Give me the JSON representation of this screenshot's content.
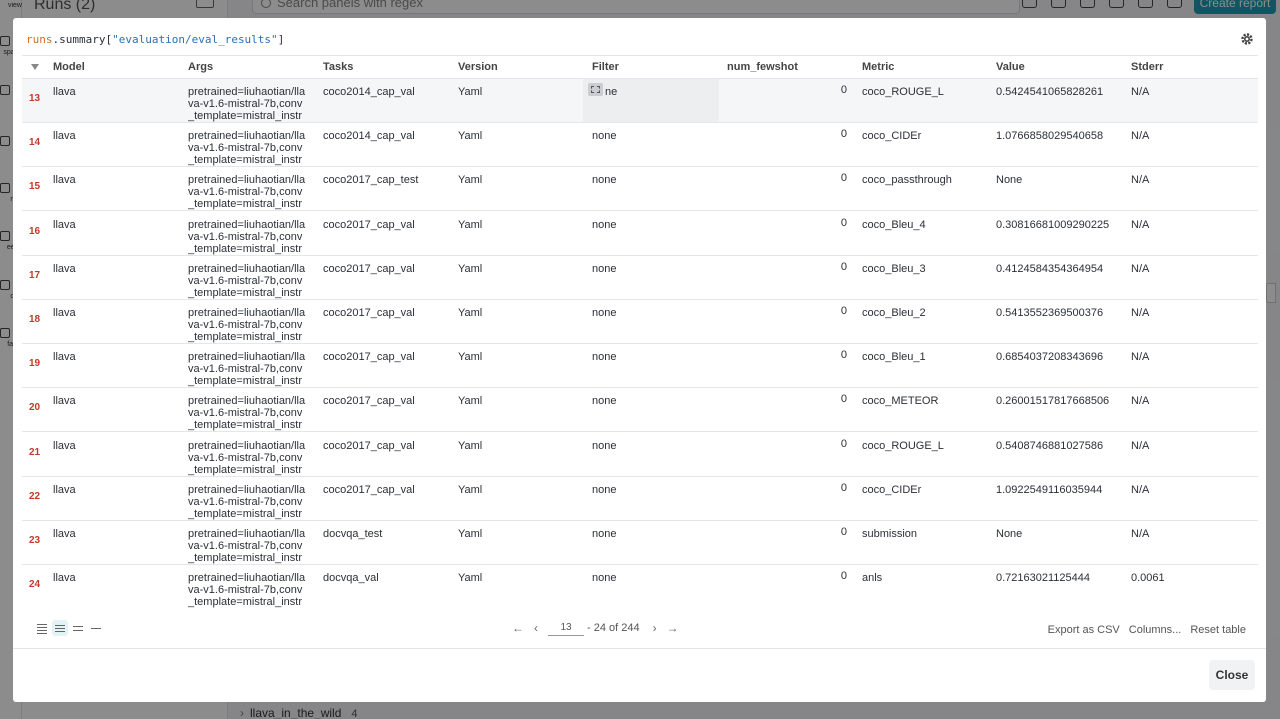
{
  "background": {
    "runs_title": "Runs (2)",
    "search_placeholder": "Search panels with regex",
    "create_report": "Create report",
    "nav_labels": [
      "view",
      "space",
      "ns",
      "bs",
      "mat",
      "eeps",
      "orts",
      "facts"
    ],
    "group_name": "llava_in_the_wild",
    "group_count": "4"
  },
  "modal": {
    "expr": {
      "prefix": "runs",
      "mid": ".summary[",
      "key": "\"evaluation/eval_results\"",
      "suffix": "]"
    },
    "columns": [
      "Model",
      "Args",
      "Tasks",
      "Version",
      "Filter",
      "num_fewshot",
      "Metric",
      "Value",
      "Stderr"
    ],
    "rows": [
      {
        "idx": "13",
        "model": "llava",
        "args": "pretrained=liuhaotian/llava-v1.6-mistral-7b,conv_template=mistral_instruct",
        "tasks": "coco2014_cap_val",
        "version": "Yaml",
        "filter": "ne",
        "fewshot": "0",
        "metric": "coco_ROUGE_L",
        "value": "0.5424541065828261",
        "stderr": "N/A"
      },
      {
        "idx": "14",
        "model": "llava",
        "args": "pretrained=liuhaotian/llava-v1.6-mistral-7b,conv_template=mistral_instruct",
        "tasks": "coco2014_cap_val",
        "version": "Yaml",
        "filter": "none",
        "fewshot": "0",
        "metric": "coco_CIDEr",
        "value": "1.0766858029540658",
        "stderr": "N/A"
      },
      {
        "idx": "15",
        "model": "llava",
        "args": "pretrained=liuhaotian/llava-v1.6-mistral-7b,conv_template=mistral_instruct",
        "tasks": "coco2017_cap_test",
        "version": "Yaml",
        "filter": "none",
        "fewshot": "0",
        "metric": "coco_passthrough",
        "value": "None",
        "stderr": "N/A"
      },
      {
        "idx": "16",
        "model": "llava",
        "args": "pretrained=liuhaotian/llava-v1.6-mistral-7b,conv_template=mistral_instruct",
        "tasks": "coco2017_cap_val",
        "version": "Yaml",
        "filter": "none",
        "fewshot": "0",
        "metric": "coco_Bleu_4",
        "value": "0.30816681009290225",
        "stderr": "N/A"
      },
      {
        "idx": "17",
        "model": "llava",
        "args": "pretrained=liuhaotian/llava-v1.6-mistral-7b,conv_template=mistral_instruct",
        "tasks": "coco2017_cap_val",
        "version": "Yaml",
        "filter": "none",
        "fewshot": "0",
        "metric": "coco_Bleu_3",
        "value": "0.4124584354364954",
        "stderr": "N/A"
      },
      {
        "idx": "18",
        "model": "llava",
        "args": "pretrained=liuhaotian/llava-v1.6-mistral-7b,conv_template=mistral_instruct",
        "tasks": "coco2017_cap_val",
        "version": "Yaml",
        "filter": "none",
        "fewshot": "0",
        "metric": "coco_Bleu_2",
        "value": "0.5413552369500376",
        "stderr": "N/A"
      },
      {
        "idx": "19",
        "model": "llava",
        "args": "pretrained=liuhaotian/llava-v1.6-mistral-7b,conv_template=mistral_instruct",
        "tasks": "coco2017_cap_val",
        "version": "Yaml",
        "filter": "none",
        "fewshot": "0",
        "metric": "coco_Bleu_1",
        "value": "0.6854037208343696",
        "stderr": "N/A"
      },
      {
        "idx": "20",
        "model": "llava",
        "args": "pretrained=liuhaotian/llava-v1.6-mistral-7b,conv_template=mistral_instruct",
        "tasks": "coco2017_cap_val",
        "version": "Yaml",
        "filter": "none",
        "fewshot": "0",
        "metric": "coco_METEOR",
        "value": "0.26001517817668506",
        "stderr": "N/A"
      },
      {
        "idx": "21",
        "model": "llava",
        "args": "pretrained=liuhaotian/llava-v1.6-mistral-7b,conv_template=mistral_instruct",
        "tasks": "coco2017_cap_val",
        "version": "Yaml",
        "filter": "none",
        "fewshot": "0",
        "metric": "coco_ROUGE_L",
        "value": "0.5408746881027586",
        "stderr": "N/A"
      },
      {
        "idx": "22",
        "model": "llava",
        "args": "pretrained=liuhaotian/llava-v1.6-mistral-7b,conv_template=mistral_instruct",
        "tasks": "coco2017_cap_val",
        "version": "Yaml",
        "filter": "none",
        "fewshot": "0",
        "metric": "coco_CIDEr",
        "value": "1.0922549116035944",
        "stderr": "N/A"
      },
      {
        "idx": "23",
        "model": "llava",
        "args": "pretrained=liuhaotian/llava-v1.6-mistral-7b,conv_template=mistral_instruct",
        "tasks": "docvqa_test",
        "version": "Yaml",
        "filter": "none",
        "fewshot": "0",
        "metric": "submission",
        "value": "None",
        "stderr": "N/A"
      },
      {
        "idx": "24",
        "model": "llava",
        "args": "pretrained=liuhaotian/llava-v1.6-mistral-7b,conv_template=mistral_instruct",
        "tasks": "docvqa_val",
        "version": "Yaml",
        "filter": "none",
        "fewshot": "0",
        "metric": "anls",
        "value": "0.72163021125444",
        "stderr": "0.0061"
      }
    ],
    "pager": {
      "page": "13",
      "range_text": "- 24 of 244"
    },
    "actions": {
      "export": "Export as CSV",
      "columns": "Columns...",
      "reset": "Reset table"
    },
    "close_label": "Close",
    "accent": "#1f9bb7"
  }
}
